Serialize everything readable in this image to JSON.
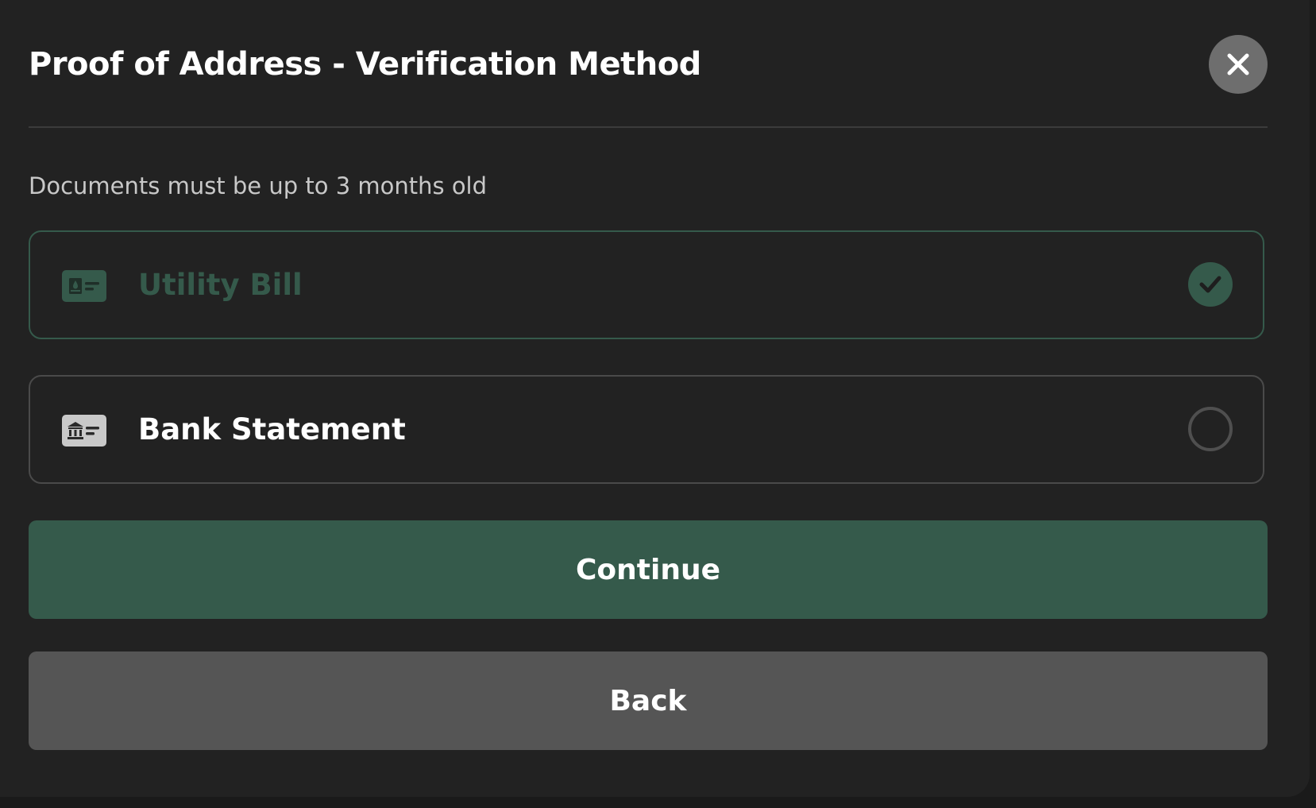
{
  "modal": {
    "title": "Proof of Address - Verification Method",
    "close_icon": "close-icon",
    "subtitle": "Documents must be up to 3 months old"
  },
  "options": [
    {
      "label": "Utility Bill",
      "icon": "utility-bill-icon",
      "selected": true,
      "status_icon": "checkmark-icon"
    },
    {
      "label": "Bank Statement",
      "icon": "bank-statement-icon",
      "selected": false,
      "status_icon": "radio-empty-icon"
    }
  ],
  "buttons": {
    "continue_label": "Continue",
    "back_label": "Back"
  },
  "colors": {
    "background": "#222222",
    "accent_green": "#355a4b",
    "secondary_button": "#555555",
    "close_button": "#6e6e6e",
    "text_primary": "#ffffff",
    "text_secondary": "#c8c8c8"
  }
}
